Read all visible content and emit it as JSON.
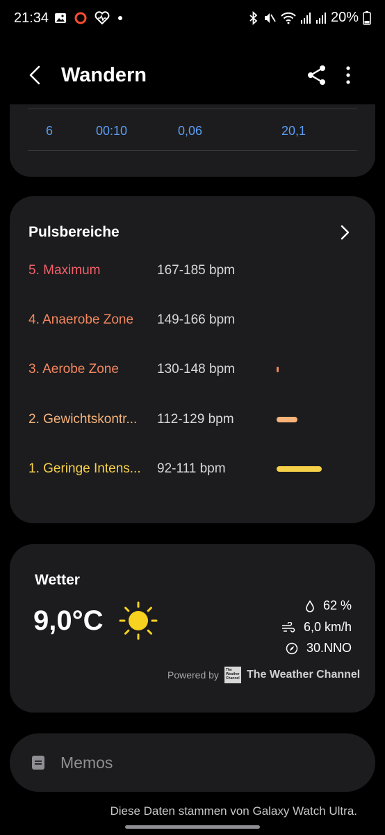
{
  "status_bar": {
    "time": "21:34",
    "battery": "20%"
  },
  "header": {
    "title": "Wandern"
  },
  "lap_row": {
    "lap": "6",
    "time": "00:10",
    "distance": "0,06",
    "speed": "20,1"
  },
  "pulse": {
    "title": "Pulsbereiche",
    "zones": [
      {
        "name": "5. Maximum",
        "range": "167-185 bpm",
        "color": "#f0606a",
        "share": 0
      },
      {
        "name": "4. Anaerobe Zone",
        "range": "149-166 bpm",
        "color": "#f2875f",
        "share": 0
      },
      {
        "name": "3. Aerobe Zone",
        "range": "130-148 bpm",
        "color": "#f2875f",
        "share": 0.03
      },
      {
        "name": "2. Gewichtskontr...",
        "range": "112-129 bpm",
        "color": "#f7b37a",
        "share": 0.3
      },
      {
        "name": "1. Geringe Intens...",
        "range": "92-111 bpm",
        "color": "#f7d04a",
        "share": 0.65
      }
    ]
  },
  "weather": {
    "title": "Wetter",
    "temperature": "9,0°C",
    "humidity": "62 %",
    "wind_speed": "6,0 km/h",
    "wind_direction": "30.NNO",
    "powered_by": "Powered by",
    "provider": "The Weather Channel",
    "logo_text": "The Weather Channel"
  },
  "memos": {
    "label": "Memos"
  },
  "footer": {
    "source_text": "Diese Daten stammen von Galaxy Watch Ultra."
  },
  "colors": {
    "accent_blue": "#5b9cf2",
    "card_bg": "#1c1c1e"
  }
}
